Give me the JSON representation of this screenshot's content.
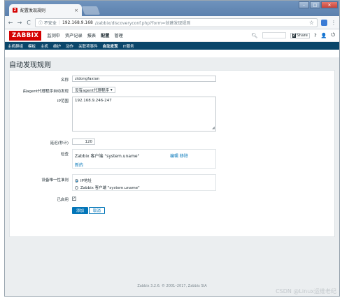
{
  "browser": {
    "tab_title": "配置发现规则",
    "tab_close": "×",
    "favicon_letter": "Z",
    "window_buttons": [
      "–",
      "□",
      "✕"
    ],
    "nav": {
      "back": "←",
      "forward": "→",
      "reload": "C"
    },
    "security_label": "ⓘ 不安全",
    "url_host": "192.168.9.168",
    "url_path": "/zabbix/discoveryconf.php?form=创建发现规则",
    "star": "☆",
    "menu": "⋮"
  },
  "header": {
    "logo": "ZABBIX",
    "menu": [
      "监测中",
      "资产记录",
      "报表",
      "配置",
      "管理"
    ],
    "share": "Share",
    "share_z": "Z",
    "help": "?",
    "user": "👤",
    "power": "⏻"
  },
  "submenu": [
    "主机群组",
    "模板",
    "主机",
    "维护",
    "动作",
    "关联项事件",
    "自动发现",
    "IT服务"
  ],
  "page": {
    "title": "自动发现规则"
  },
  "form": {
    "name_label": "名称",
    "name_value": "zidongfaxian",
    "proxy_label": "由agent代理程序自动发现",
    "proxy_value": "没有agent代理程序",
    "iprange_label": "IP范围",
    "iprange_value": "192.168.9.246-247",
    "delay_label": "延迟(秒计)",
    "delay_value": "120",
    "checks_label": "检查",
    "check_item": "Zabbix 客户端 \"system.uname\"",
    "check_edit": "编辑",
    "check_remove": "移除",
    "check_new": "新的",
    "uniq_label": "设备唯一性准则",
    "uniq_options": [
      "IP地址",
      "Zabbix 客户端 \"system.uname\""
    ],
    "enabled_label": "已启用",
    "enabled_check": "✓",
    "add_button": "添加",
    "cancel_button": "取消"
  },
  "footer": "Zabbix 3.2.6. © 2001–2017, Zabbix SIA",
  "watermark": "CSDN @Linux运维老纪"
}
